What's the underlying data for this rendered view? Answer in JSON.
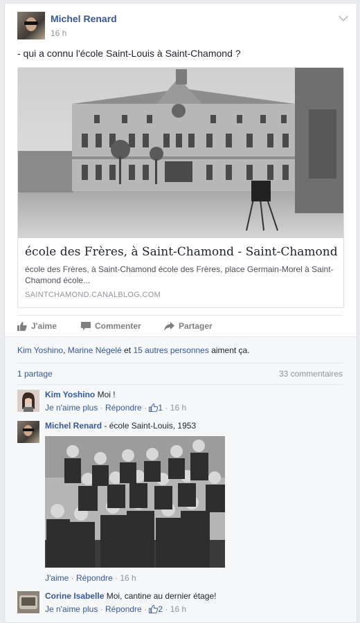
{
  "post": {
    "author": "Michel Renard",
    "time": "16 h",
    "status": "- qui a connu l'école Saint-Louis à Saint-Chamond ?"
  },
  "link": {
    "title": "école des Frères, à Saint-Chamond - Saint-Chamond",
    "description": "école des Frères, à Saint-Chamond école des Frères, place Germain-Morel à Saint-Chamond école...",
    "domain": "SAINTCHAMOND.CANALBLOG.COM"
  },
  "actions": {
    "like": "J'aime",
    "comment": "Commenter",
    "share": "Partager"
  },
  "likes": {
    "person1": "Kim Yoshino",
    "sep1": ", ",
    "person2": "Marine Négelé",
    "and": " et ",
    "others": "15 autres personnes",
    "suffix": " aiment ça."
  },
  "stats": {
    "shares": "1 partage",
    "comments": "33 commentaires"
  },
  "comments": [
    {
      "author": "Kim Yoshino",
      "text": "Moi !",
      "unlike": "Je n'aime plus",
      "reply": "Répondre",
      "likes": "1",
      "time": "16 h",
      "dot": " · "
    },
    {
      "author": "Michel Renard",
      "text": " - école Saint-Louis, 1953",
      "like": "J'aime",
      "reply": "Répondre",
      "time": "16 h",
      "dot": " · "
    },
    {
      "author": "Corine Isabelle",
      "text": "Moi, cantine au dernier étage!",
      "unlike": "Je n'aime plus",
      "reply": "Répondre",
      "likes": "2",
      "time": "16 h",
      "dot": " · "
    }
  ],
  "colors": {
    "link_blue": "#365899",
    "meta_gray": "#90949c",
    "background": "#e9ebee"
  }
}
